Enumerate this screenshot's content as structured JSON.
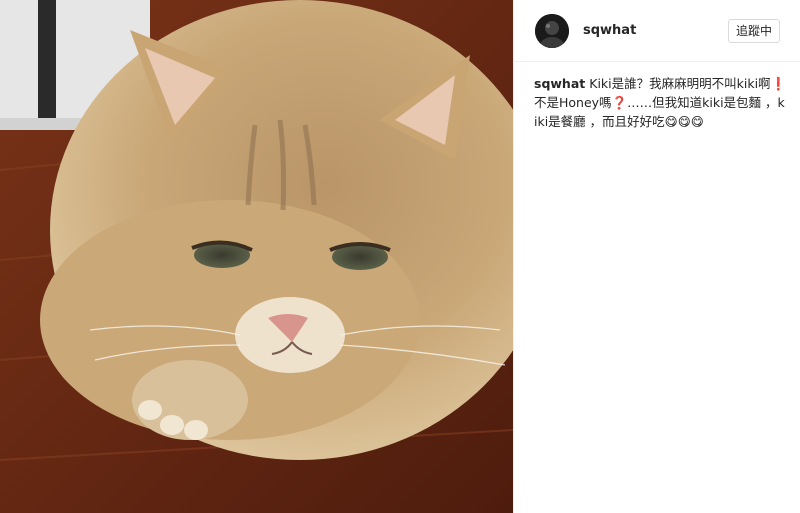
{
  "post": {
    "image_alt": "Long-haired golden cat lying on a wooden floor",
    "author": {
      "username": "sqwhat"
    },
    "follow_button_label": "追蹤中",
    "caption": {
      "username": "sqwhat",
      "text": "Kiki是誰？我麻麻明明不叫kiki啊❗️不是Honey嗎❓……但我知道kiki是包麵 ，kiki是餐廳 ，而且好好吃😋😋😋"
    }
  },
  "colors": {
    "floor": "#6a2a16",
    "fur": "#c9a777",
    "border": "#efefef",
    "text": "#262626"
  },
  "icons": {
    "avatar": "profile-avatar"
  }
}
